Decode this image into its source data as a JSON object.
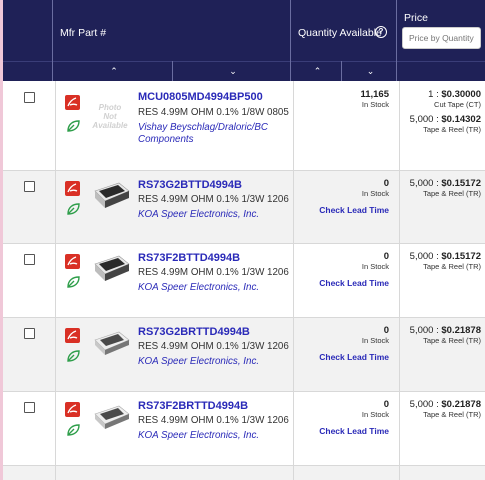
{
  "header": {
    "mfr_part_label": "Mfr Part #",
    "qty_label": "Quantity Available",
    "help_icon": "?",
    "price_label": "Price",
    "price_placeholder": "Price by Quantity",
    "sort_up": "⌃",
    "sort_down": "⌄"
  },
  "rows": [
    {
      "part": "MCU0805MD4994BP500",
      "desc": "RES 4.99M OHM 0.1% 1/8W 0805",
      "mfr_line1": "Vishay Beyschlag/Draloric/BC",
      "mfr_line2": "Components",
      "photo": "Photo Not Available",
      "qty": "11,165",
      "stock": "In Stock",
      "price1_qty": "1 : ",
      "price1_val": "$0.30000",
      "price1_pkg": "Cut Tape (CT)",
      "price2_qty": "5,000 : ",
      "price2_val": "$0.14302",
      "price2_pkg": "Tape & Reel (TR)"
    },
    {
      "part": "RS73G2BTTD4994B",
      "desc": "RES 4.99M OHM 0.1% 1/3W 1206",
      "mfr_line1": "KOA Speer Electronics, Inc.",
      "qty": "0",
      "stock": "In Stock",
      "lead": "Check Lead Time",
      "price1_qty": "5,000 : ",
      "price1_val": "$0.15172",
      "price1_pkg": "Tape & Reel (TR)"
    },
    {
      "part": "RS73F2BTTD4994B",
      "desc": "RES 4.99M OHM 0.1% 1/3W 1206",
      "mfr_line1": "KOA Speer Electronics, Inc.",
      "qty": "0",
      "stock": "In Stock",
      "lead": "Check Lead Time",
      "price1_qty": "5,000 : ",
      "price1_val": "$0.15172",
      "price1_pkg": "Tape & Reel (TR)"
    },
    {
      "part": "RS73G2BRTTD4994B",
      "desc": "RES 4.99M OHM 0.1% 1/3W 1206",
      "mfr_line1": "KOA Speer Electronics, Inc.",
      "qty": "0",
      "stock": "In Stock",
      "lead": "Check Lead Time",
      "price1_qty": "5,000 : ",
      "price1_val": "$0.21878",
      "price1_pkg": "Tape & Reel (TR)"
    },
    {
      "part": "RS73F2BRTTD4994B",
      "desc": "RES 4.99M OHM 0.1% 1/3W 1206",
      "mfr_line1": "KOA Speer Electronics, Inc.",
      "qty": "0",
      "stock": "In Stock",
      "lead": "Check Lead Time",
      "price1_qty": "5,000 : ",
      "price1_val": "$0.21878",
      "price1_pkg": "Tape & Reel (TR)"
    }
  ],
  "colors": {
    "header_bg": "#1f2157",
    "link": "#2a2ab8",
    "pdf_red": "#d93025",
    "leaf_green": "#2e9e4a"
  }
}
